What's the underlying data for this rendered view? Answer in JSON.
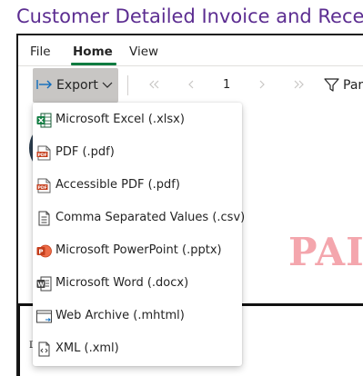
{
  "page": {
    "title": "Customer Detailed Invoice and Receipt"
  },
  "ribbon": {
    "tabs": [
      {
        "label": "File",
        "active": false
      },
      {
        "label": "Home",
        "active": true
      },
      {
        "label": "View",
        "active": false
      }
    ],
    "accent_color": "#107c41"
  },
  "toolbar": {
    "export_label": "Export",
    "page_number": "1",
    "params_label": "Parameters"
  },
  "export_menu": {
    "items": [
      {
        "label": "Microsoft Excel (.xlsx)",
        "icon": "excel-icon"
      },
      {
        "label": "PDF (.pdf)",
        "icon": "pdf-icon"
      },
      {
        "label": "Accessible PDF (.pdf)",
        "icon": "accessible-pdf-icon"
      },
      {
        "label": "Comma Separated Values (.csv)",
        "icon": "csv-icon"
      },
      {
        "label": "Microsoft PowerPoint (.pptx)",
        "icon": "powerpoint-icon"
      },
      {
        "label": "Microsoft Word (.docx)",
        "icon": "word-icon"
      },
      {
        "label": "Web Archive (.mhtml)",
        "icon": "web-archive-icon"
      },
      {
        "label": "XML (.xml)",
        "icon": "xml-icon"
      }
    ]
  },
  "report": {
    "watermark": "PAID",
    "watermark_color": "#f4a6ad",
    "letter": "D"
  }
}
